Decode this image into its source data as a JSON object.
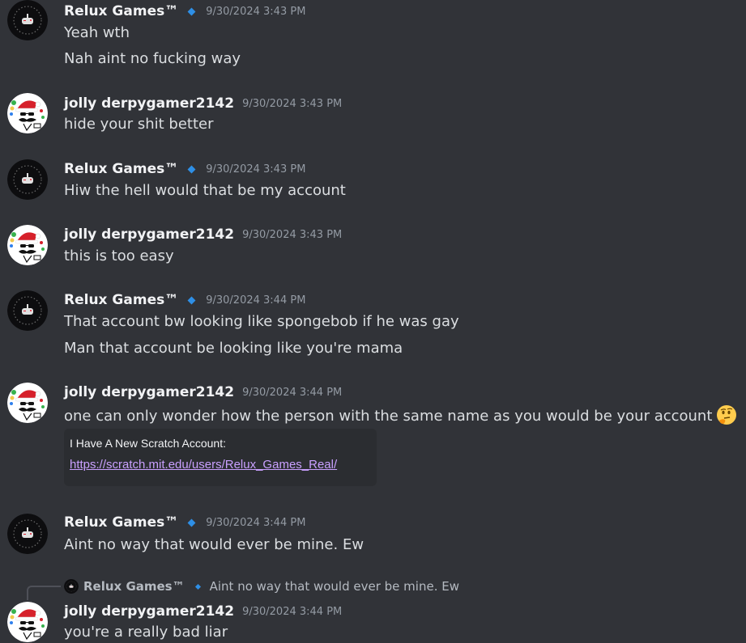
{
  "users": {
    "relux": {
      "name": "Relux Games™",
      "avatar_icon": "gamepad-icon"
    },
    "jolly": {
      "name": "jolly derpygamer2142",
      "avatar_icon": "santa-face-icon"
    }
  },
  "messages": [
    {
      "author": "Relux Games™",
      "timestamp": "9/30/2024 3:43 PM",
      "lines": [
        "Yeah wth",
        "Nah aint no fucking way"
      ]
    },
    {
      "author": "jolly derpygamer2142",
      "timestamp": "9/30/2024 3:43 PM",
      "lines": [
        "hide your shit better"
      ]
    },
    {
      "author": "Relux Games™",
      "timestamp": "9/30/2024 3:43 PM",
      "lines": [
        "Hiw the hell would that be my account"
      ]
    },
    {
      "author": "jolly derpygamer2142",
      "timestamp": "9/30/2024 3:43 PM",
      "lines": [
        "this is too easy"
      ]
    },
    {
      "author": "Relux Games™",
      "timestamp": "9/30/2024 3:44 PM",
      "lines": [
        "That account bw looking like spongebob if he was gay",
        "Man that account be looking like you're mama"
      ]
    },
    {
      "author": "jolly derpygamer2142",
      "timestamp": "9/30/2024 3:44 PM",
      "lines": [
        "one can only wonder how the person with the same name as you would be your account"
      ],
      "emoji": "thinking-face-icon",
      "embed": {
        "title": "I Have A New Scratch Account:",
        "link": "https://scratch.mit.edu/users/Relux_Games_Real/"
      }
    },
    {
      "author": "Relux Games™",
      "timestamp": "9/30/2024 3:44 PM",
      "lines": [
        "Aint no way that would ever be mine. Ew"
      ]
    },
    {
      "author": "jolly derpygamer2142",
      "timestamp": "9/30/2024 3:44 PM",
      "lines": [
        "you're a really bad liar"
      ],
      "reply": {
        "author": "Relux Games™",
        "text": "Aint no way that would ever be mine. Ew"
      }
    }
  ],
  "colors": {
    "background": "#313338",
    "username": "#f2f3f5",
    "timestamp": "#949ba4",
    "badge": "#2e8fe6",
    "link": "#c9a0ff",
    "embed_bg": "#2b2d31"
  }
}
